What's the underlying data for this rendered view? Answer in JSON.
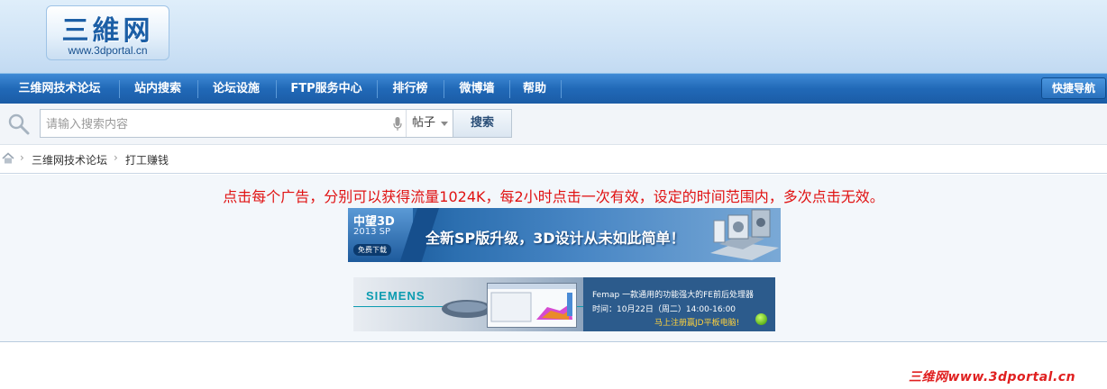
{
  "site": {
    "logo_title": "三維网",
    "logo_url": "www.3dportal.cn"
  },
  "nav": {
    "items": [
      {
        "label": "三维网技术论坛"
      },
      {
        "label": "站内搜索"
      },
      {
        "label": "论坛设施"
      },
      {
        "label": "FTP服务中心"
      },
      {
        "label": "排行榜"
      },
      {
        "label": "微博墙"
      },
      {
        "label": "帮助"
      }
    ],
    "quick_nav": "快捷导航"
  },
  "search": {
    "placeholder": "请输入搜索内容",
    "type": "帖子",
    "button": "搜索"
  },
  "breadcrumb": {
    "items": [
      "三维网技术论坛",
      "打工赚钱"
    ]
  },
  "content": {
    "notice": "点击每个广告，分别可以获得流量1024K，每2小时点击一次有效，设定的时间范围内，多次点击无效。",
    "ad1": {
      "brand": "中望3D",
      "version": "2013 SP",
      "free": "免费下载",
      "slogan": "全新SP版升级，3D设计从未如此简单！"
    },
    "ad2": {
      "brand": "SIEMENS",
      "line1": "Femap  一款通用的功能强大的FE前后处理器",
      "line2": "时间：10月22日（周二）14:00-16:00",
      "line3": "马上注册赢JD平板电脑!"
    }
  },
  "watermark": "三维网www.3dportal.cn",
  "colors": {
    "nav_bg": "#2169b7",
    "notice": "#e01212",
    "header_bg": "#cfe3f6"
  }
}
